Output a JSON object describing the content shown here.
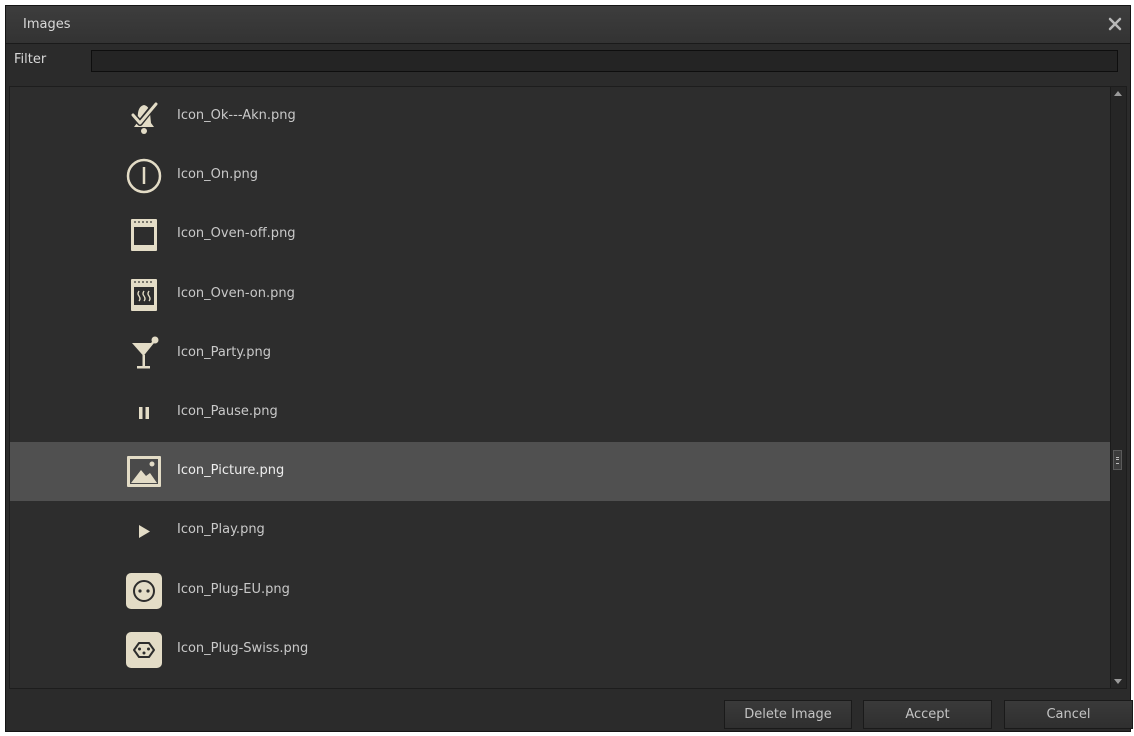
{
  "window": {
    "title": "Images"
  },
  "filter": {
    "label": "Filter",
    "value": "",
    "placeholder": ""
  },
  "list": {
    "items": [
      {
        "label": "Icon_Ok---Akn.png",
        "icon": "bell-check-icon",
        "selected": false
      },
      {
        "label": "Icon_On.png",
        "icon": "power-on-icon",
        "selected": false
      },
      {
        "label": "Icon_Oven-off.png",
        "icon": "oven-off-icon",
        "selected": false
      },
      {
        "label": "Icon_Oven-on.png",
        "icon": "oven-on-icon",
        "selected": false
      },
      {
        "label": "Icon_Party.png",
        "icon": "cocktail-icon",
        "selected": false
      },
      {
        "label": "Icon_Pause.png",
        "icon": "pause-icon",
        "selected": false
      },
      {
        "label": "Icon_Picture.png",
        "icon": "picture-icon",
        "selected": true
      },
      {
        "label": "Icon_Play.png",
        "icon": "play-icon",
        "selected": false
      },
      {
        "label": "Icon_Plug-EU.png",
        "icon": "plug-eu-icon",
        "selected": false
      },
      {
        "label": "Icon_Plug-Swiss.png",
        "icon": "plug-swiss-icon",
        "selected": false
      }
    ]
  },
  "buttons": {
    "delete": "Delete Image",
    "accept": "Accept",
    "cancel": "Cancel"
  },
  "colors": {
    "background": "#2b2b2b",
    "selected_row": "#505050",
    "icon_fill": "#e3dcc6",
    "text": "#c9c9c9"
  }
}
